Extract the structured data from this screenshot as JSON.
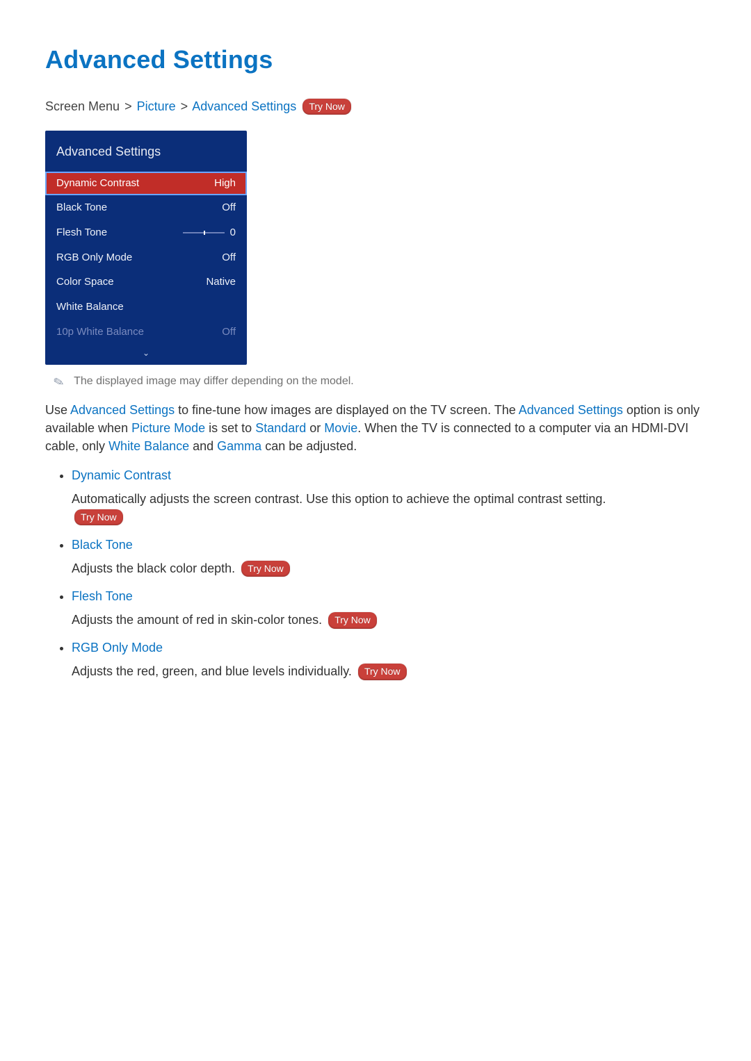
{
  "title": "Advanced Settings",
  "breadcrumb": {
    "root": "Screen Menu",
    "sep": ">",
    "level1": "Picture",
    "level2": "Advanced Settings",
    "try_now": "Try Now"
  },
  "panel": {
    "title": "Advanced Settings",
    "rows": [
      {
        "label": "Dynamic Contrast",
        "value": "High",
        "selected": true
      },
      {
        "label": "Black Tone",
        "value": "Off"
      },
      {
        "label": "Flesh Tone",
        "value": "0",
        "slider": true
      },
      {
        "label": "RGB Only Mode",
        "value": "Off"
      },
      {
        "label": "Color Space",
        "value": "Native"
      },
      {
        "label": "White Balance",
        "value": ""
      },
      {
        "label": "10p White Balance",
        "value": "Off",
        "dim": true
      }
    ],
    "more_glyph": "⌄"
  },
  "note": "The displayed image may differ depending on the model.",
  "note_icon": "✎",
  "intro": {
    "t1": "Use ",
    "kw1": "Advanced Settings",
    "t2": " to fine-tune how images are displayed on the TV screen. The ",
    "kw2": "Advanced Settings",
    "t3": " option is only available when ",
    "kw3": "Picture Mode",
    "t4": " is set to ",
    "kw4": "Standard",
    "t5": " or ",
    "kw5": "Movie",
    "t6": ". When the TV is connected to a computer via an HDMI-DVI cable, only ",
    "kw6": "White Balance",
    "t7": " and ",
    "kw7": "Gamma",
    "t8": " can be adjusted."
  },
  "features": [
    {
      "name": "Dynamic Contrast",
      "desc": "Automatically adjusts the screen contrast. Use this option to achieve the optimal contrast setting.",
      "try_now": "Try Now",
      "try_now_below": true
    },
    {
      "name": "Black Tone",
      "desc": "Adjusts the black color depth.",
      "try_now": "Try Now"
    },
    {
      "name": "Flesh Tone",
      "desc": "Adjusts the amount of red in skin-color tones.",
      "try_now": "Try Now"
    },
    {
      "name": "RGB Only Mode",
      "desc": "Adjusts the red, green, and blue levels individually.",
      "try_now": "Try Now"
    }
  ]
}
